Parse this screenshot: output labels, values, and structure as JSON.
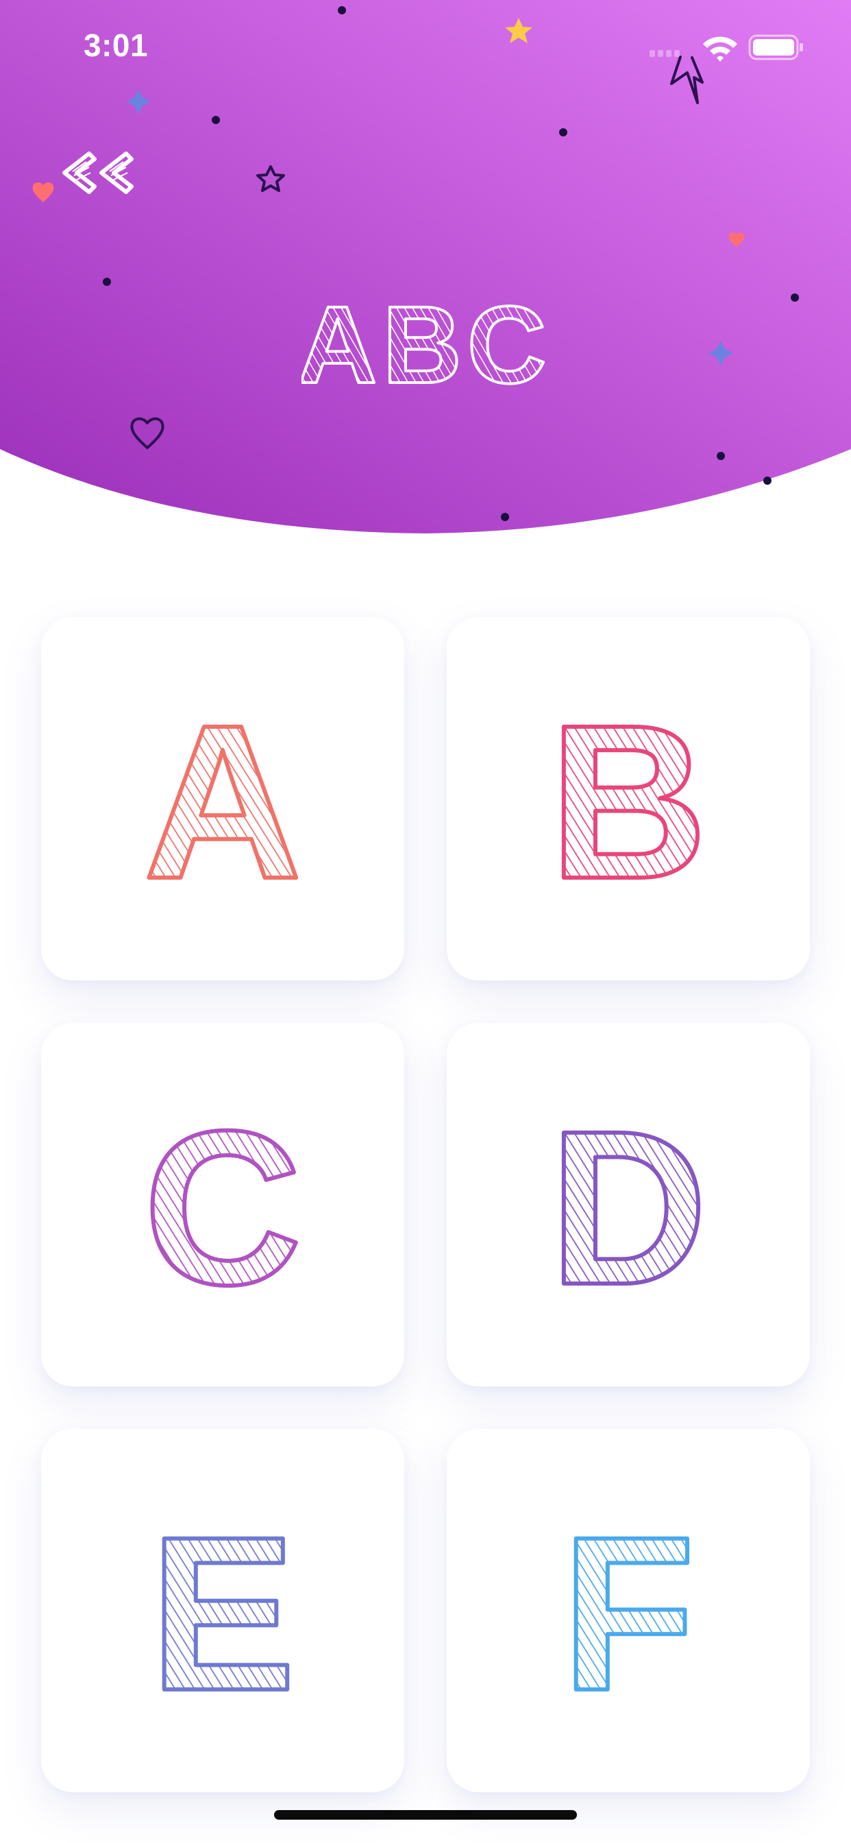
{
  "status_bar": {
    "time": "3:01"
  },
  "header": {
    "title": "ABC",
    "back_icon": "double-chevron-left-icon",
    "gradient": {
      "start": "#9b2fb9",
      "end": "#e27cf5"
    }
  },
  "letters": [
    {
      "letter": "A",
      "color": "#f07268"
    },
    {
      "letter": "B",
      "color": "#e8467a"
    },
    {
      "letter": "C",
      "color": "#b052c2"
    },
    {
      "letter": "D",
      "color": "#8656c2"
    },
    {
      "letter": "E",
      "color": "#6e7ad0"
    },
    {
      "letter": "F",
      "color": "#4aa9ec"
    }
  ]
}
